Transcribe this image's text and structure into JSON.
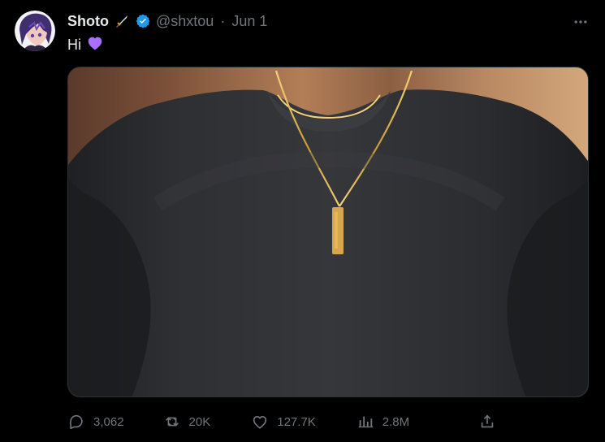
{
  "tweet": {
    "author": {
      "display_name": "Shoto",
      "name_emoji": "dagger-icon",
      "verified_badge": "verified-icon",
      "handle": "@shxtou",
      "separator": "·",
      "date": "Jun 1"
    },
    "text": "Hi",
    "text_emoji": "purple-heart-icon",
    "more_menu_icon": "more-horizontal-icon",
    "media": {
      "subject": "photo"
    },
    "actions": {
      "replies": "3,062",
      "retweets": "20K",
      "likes": "127.7K",
      "views": "2.8M",
      "reply_icon": "reply-icon",
      "retweet_icon": "retweet-icon",
      "like_icon": "heart-icon",
      "views_icon": "views-icon",
      "share_icon": "share-icon"
    }
  },
  "colors": {
    "background": "#000000",
    "text_primary": "#e7e9ea",
    "text_secondary": "#71767b",
    "verified_blue": "#1d9bf0",
    "purple_heart": "#a970ff"
  }
}
